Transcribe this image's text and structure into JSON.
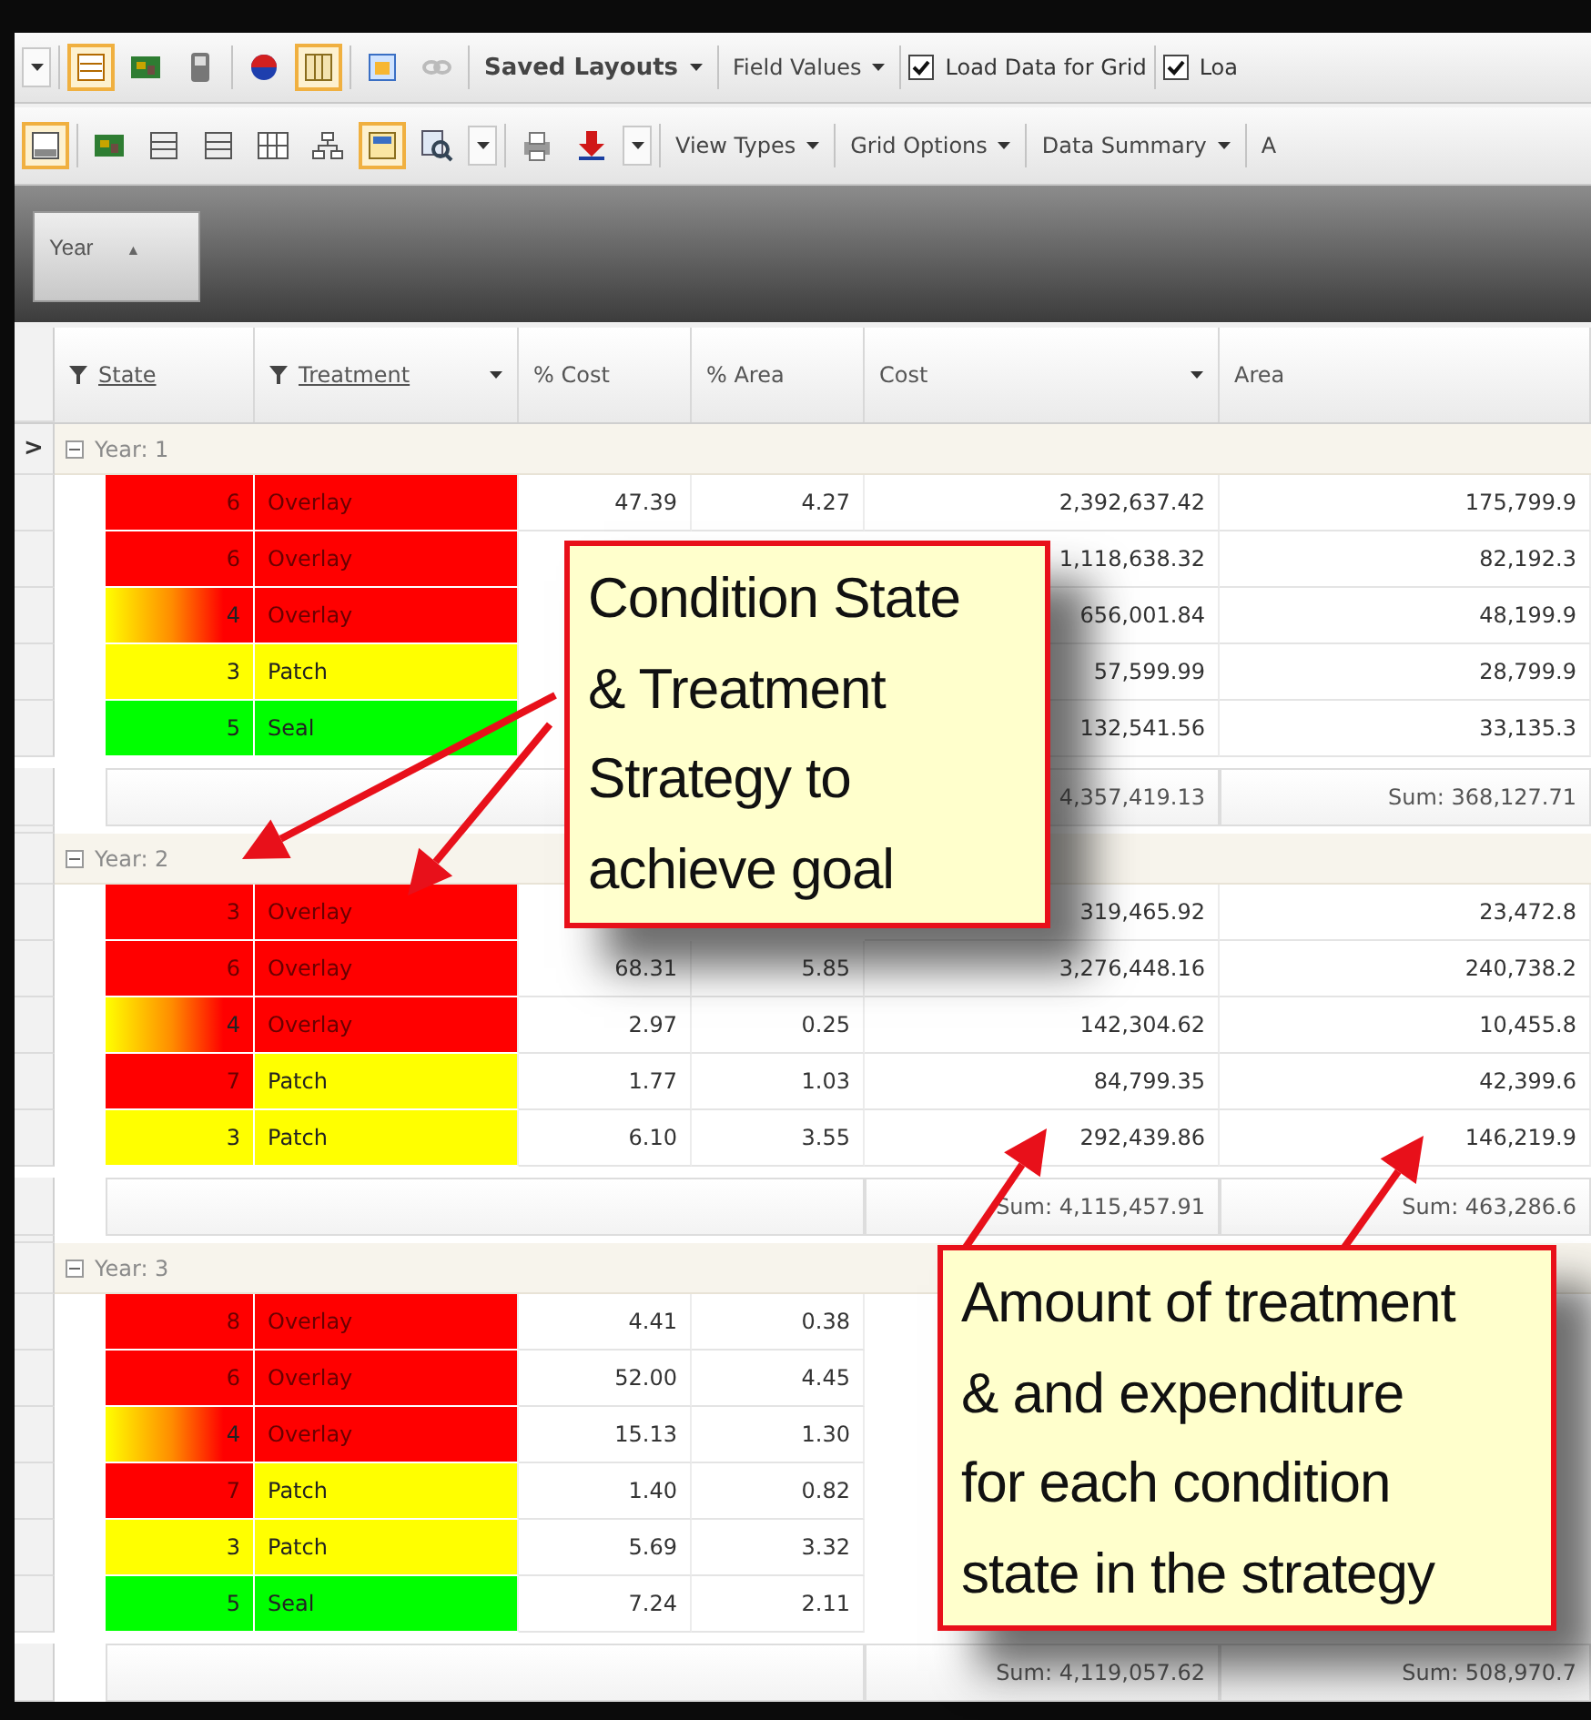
{
  "toolbars": [
    {
      "items": [
        {
          "kind": "dropdown"
        },
        {
          "kind": "separator"
        },
        {
          "kind": "icon",
          "selected": true
        },
        {
          "kind": "icon",
          "selected": false
        },
        {
          "kind": "icon",
          "selected": false
        },
        {
          "kind": "separator"
        },
        {
          "kind": "icon",
          "selected": false
        },
        {
          "kind": "icon",
          "selected": true
        },
        {
          "kind": "separator"
        },
        {
          "kind": "icon",
          "selected": false
        },
        {
          "kind": "icon",
          "selected": false
        },
        {
          "kind": "separator"
        },
        {
          "kind": "menu",
          "label": "Saved Layouts",
          "bold": true
        },
        {
          "kind": "separator"
        },
        {
          "kind": "menu",
          "label": "Field Values",
          "bold": false
        },
        {
          "kind": "separator"
        },
        {
          "kind": "check",
          "label": "Load Data for Grid",
          "checked": true
        },
        {
          "kind": "separator"
        },
        {
          "kind": "check",
          "label": "Loa",
          "checked": true
        }
      ]
    },
    {
      "items": [
        {
          "kind": "icon",
          "selected": true
        },
        {
          "kind": "separator"
        },
        {
          "kind": "icon",
          "selected": false
        },
        {
          "kind": "icon",
          "selected": false
        },
        {
          "kind": "icon",
          "selected": false
        },
        {
          "kind": "icon",
          "selected": false
        },
        {
          "kind": "icon",
          "selected": false
        },
        {
          "kind": "icon",
          "selected": true
        },
        {
          "kind": "icon",
          "selected": false
        },
        {
          "kind": "dropdown"
        },
        {
          "kind": "separator"
        },
        {
          "kind": "icon",
          "selected": false
        },
        {
          "kind": "icon",
          "selected": false
        },
        {
          "kind": "dropdown"
        },
        {
          "kind": "separator"
        },
        {
          "kind": "menu",
          "label": "View Types",
          "bold": false
        },
        {
          "kind": "separator"
        },
        {
          "kind": "menu",
          "label": "Grid Options",
          "bold": false
        },
        {
          "kind": "separator"
        },
        {
          "kind": "menu",
          "label": "Data Summary",
          "bold": false
        },
        {
          "kind": "separator"
        },
        {
          "kind": "label",
          "label": "A"
        }
      ]
    }
  ],
  "group_panel": {
    "chips": [
      {
        "label": "Year",
        "sort": "▲"
      }
    ]
  },
  "columns": [
    {
      "label": "State",
      "filtered": true,
      "menu": false
    },
    {
      "label": "Treatment",
      "filtered": true,
      "menu": true
    },
    {
      "label": "% Cost",
      "filtered": false,
      "menu": false
    },
    {
      "label": "% Area",
      "filtered": false,
      "menu": false
    },
    {
      "label": "Cost",
      "filtered": false,
      "menu": true
    },
    {
      "label": "Area",
      "filtered": false,
      "menu": false
    }
  ],
  "groups": [
    {
      "label": "Year: 1",
      "expanded": true,
      "indicator": ">",
      "rows": [
        {
          "state": {
            "text": "6",
            "color": "#ff0000"
          },
          "treatment": {
            "text": "Overlay",
            "color": "#ff0000"
          },
          "pct_cost": "47.39",
          "pct_area": "4.27",
          "cost": "2,392,637.42",
          "area": "175,799.9"
        },
        {
          "state": {
            "text": "6",
            "color": "#ff0000"
          },
          "treatment": {
            "text": "Overlay",
            "color": "#ff0000"
          },
          "cost": "1,118,638.32",
          "area": "82,192.3"
        },
        {
          "state": {
            "text": "4",
            "color": "#ff0000",
            "kind": "gradient"
          },
          "treatment": {
            "text": "Overlay",
            "color": "#ff0000"
          },
          "cost": "656,001.84",
          "area": "48,199.9"
        },
        {
          "state": {
            "text": "3",
            "color": "#ffff00"
          },
          "treatment": {
            "text": "Patch",
            "color": "#ffff00"
          },
          "cost": "57,599.99",
          "area": "28,799.9"
        },
        {
          "state": {
            "text": "5",
            "color": "#00ff00"
          },
          "treatment": {
            "text": "Seal",
            "color": "#00ff00"
          },
          "cost": "132,541.56",
          "area": "33,135.3"
        }
      ],
      "sum": {
        "cost": "4,357,419.13",
        "area": "Sum: 368,127.71"
      }
    },
    {
      "label": "Year: 2",
      "expanded": true,
      "rows": [
        {
          "state": {
            "text": "3",
            "color": "#ff0000"
          },
          "treatment": {
            "text": "Overlay",
            "color": "#ff0000"
          },
          "cost": "319,465.92",
          "area": "23,472.8"
        },
        {
          "state": {
            "text": "6",
            "color": "#ff0000"
          },
          "treatment": {
            "text": "Overlay",
            "color": "#ff0000"
          },
          "pct_cost": "68.31",
          "pct_area": "5.85",
          "cost": "3,276,448.16",
          "area": "240,738.2"
        },
        {
          "state": {
            "text": "4",
            "color": "#ff0000",
            "kind": "gradient"
          },
          "treatment": {
            "text": "Overlay",
            "color": "#ff0000"
          },
          "pct_cost": "2.97",
          "pct_area": "0.25",
          "cost": "142,304.62",
          "area": "10,455.8"
        },
        {
          "state": {
            "text": "7",
            "color": "#ff0000"
          },
          "treatment": {
            "text": "Patch",
            "color": "#ffff00"
          },
          "pct_cost": "1.77",
          "pct_area": "1.03",
          "cost": "84,799.35",
          "area": "42,399.6"
        },
        {
          "state": {
            "text": "3",
            "color": "#ffff00"
          },
          "treatment": {
            "text": "Patch",
            "color": "#ffff00"
          },
          "pct_cost": "6.10",
          "pct_area": "3.55",
          "cost": "292,439.86",
          "area": "146,219.9"
        }
      ],
      "sum": {
        "cost": "Sum: 4,115,457.91",
        "area": "Sum: 463,286.6"
      }
    },
    {
      "label": "Year: 3",
      "expanded": true,
      "rows": [
        {
          "state": {
            "text": "8",
            "color": "#ff0000"
          },
          "treatment": {
            "text": "Overlay",
            "color": "#ff0000"
          },
          "pct_cost": "4.41",
          "pct_area": "0.38"
        },
        {
          "state": {
            "text": "6",
            "color": "#ff0000"
          },
          "treatment": {
            "text": "Overlay",
            "color": "#ff0000"
          },
          "pct_cost": "52.00",
          "pct_area": "4.45"
        },
        {
          "state": {
            "text": "4",
            "color": "#ff0000",
            "kind": "gradient"
          },
          "treatment": {
            "text": "Overlay",
            "color": "#ff0000"
          },
          "pct_cost": "15.13",
          "pct_area": "1.30"
        },
        {
          "state": {
            "text": "7",
            "color": "#ff0000"
          },
          "treatment": {
            "text": "Patch",
            "color": "#ffff00"
          },
          "pct_cost": "1.40",
          "pct_area": "0.82"
        },
        {
          "state": {
            "text": "3",
            "color": "#ffff00"
          },
          "treatment": {
            "text": "Patch",
            "color": "#ffff00"
          },
          "pct_cost": "5.69",
          "pct_area": "3.32"
        },
        {
          "state": {
            "text": "5",
            "color": "#00ff00"
          },
          "treatment": {
            "text": "Seal",
            "color": "#00ff00"
          },
          "pct_cost": "7.24",
          "pct_area": "2.11"
        }
      ],
      "sum": {
        "cost": "Sum: 4,119,057.62",
        "area": "Sum: 508,970.7"
      }
    }
  ],
  "callouts": [
    {
      "lines": [
        "Condition State",
        "& Treatment",
        "Strategy to",
        "achieve goal"
      ]
    },
    {
      "lines": [
        "Amount of treatment",
        "& and expenditure",
        "for each condition",
        "state in the strategy"
      ]
    }
  ]
}
